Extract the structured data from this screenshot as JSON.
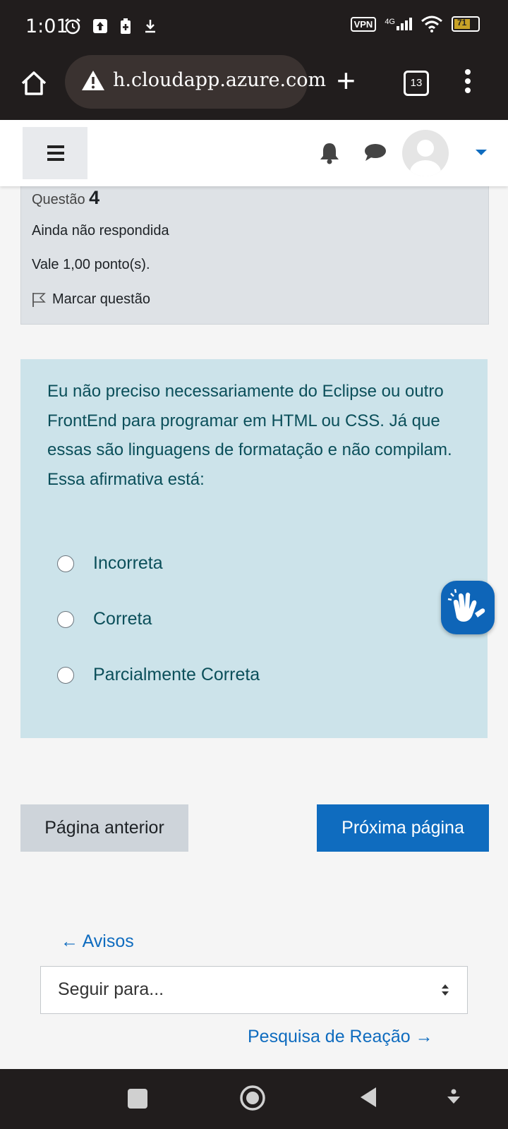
{
  "status_bar": {
    "time": "1:01",
    "network": "4G",
    "vpn_label": "VPN",
    "battery": "71"
  },
  "browser": {
    "url": "h.cloudapp.azure.com",
    "tab_count": "13"
  },
  "question": {
    "number_label": "Questão",
    "number": "4",
    "state": "Ainda não respondida",
    "grade": "Vale 1,00 ponto(s).",
    "flag_label": "Marcar questão",
    "prompt": "Eu não preciso necessariamente do Eclipse ou outro FrontEnd para programar em HTML ou CSS. Já que essas são linguagens de formatação e não compilam. Essa afirmativa está:",
    "answers": [
      "Incorreta",
      "Correta",
      "Parcialmente Correta"
    ]
  },
  "navigation": {
    "prev_button": "Página anterior",
    "next_button": "Próxima página",
    "prev_activity": "← Avisos",
    "jump_select": "Seguir para...",
    "next_activity": "Pesquisa de Reação →"
  },
  "colors": {
    "primary": "#0f6cbf",
    "question_bg": "#cce3ea",
    "info_bg": "#dee2e6",
    "chrome_bg": "#211d1d"
  }
}
